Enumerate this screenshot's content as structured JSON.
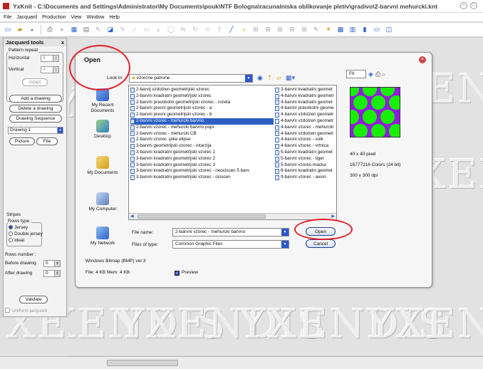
{
  "window": {
    "title": "YxKnit - C:\\Documents and Settings\\Administrator\\My Documents\\pouk\\NTF Bologna\\racunalniska oblikovanje pletiv\\gradivo\\2-barvni mehurcki.knt"
  },
  "menu": [
    "File",
    "Jacquard",
    "Production",
    "View",
    "Window",
    "Help"
  ],
  "watermark": "YXENDIS",
  "panel": {
    "title": "Jacquard tools",
    "close_label": "x",
    "pattern_repeat_label": "Pattern repeat",
    "horizontal_label": "Horizontal",
    "horizontal_value": "4",
    "vertical_label": "Vertical",
    "vertical_value": "4",
    "adapt_label": "Adapt",
    "add_drawing_label": "Add a drawing",
    "delete_drawing_label": "Delete a drawing",
    "drawing_sequence_label": "Drawing Sequence",
    "drawing_select_value": "Drawing 1",
    "picture_label": "Picture",
    "file_label": "File",
    "stripes_label": "Stripes",
    "rows_type_label": "Rows type :",
    "rows_types": [
      "Jersey",
      "Double jersey",
      "Ideal"
    ],
    "selected_row_type": "Jersey",
    "rows_number_label": "Rows number :",
    "before_drawing_label": "Before drawing",
    "before_drawing_value": "0",
    "after_drawing_label": "After drawing",
    "after_drawing_value": "0",
    "validate_label": "Validate",
    "uniform_jacquard_label": "Uniform jacquard"
  },
  "dialog": {
    "title": "Open",
    "look_in_label": "Look in:",
    "look_in_value": "vzorcne patrone",
    "view_mode_value": "Fit",
    "places": [
      "My Recent Documents",
      "Desktop",
      "My Documents",
      "My Computer",
      "My Network"
    ],
    "files_col1": [
      "2-barvij vzdolzen geometrijski vzorec",
      "2-barvni kvadratni geometrijski vzorec",
      "2-barvni pravokotni geometrijski vzorec - rozeta",
      "2-barvni precni geometrijski vzorec - a",
      "2-barvni precni geometrijski vzorec - b",
      "2-barvni vzorec - mehurcki barvno",
      "2-barvni vzorec - mehurcki barvno popr",
      "2-barvni vzorec - mehurcki CB",
      "2-barvni vzorec -pike elipse",
      "3-barvni geometrijski vzorec - intarzija",
      "3-barvni kvadratni geometrijski vzorec 1",
      "3-barvni kvadratni geometrijski vzorec 2",
      "3-barvni kvadratni geometrijski vzorec 3",
      "3-barvni kvadratni geometrijski vzorec - neociscen 5 barv",
      "3-barvni kvadratni geometrijski vzorec - ociscen"
    ],
    "selected_file": "2-barvni vzorec - mehurcki barvno",
    "files_col2": [
      "3-barvni kvadratni geomet",
      "4-barvni kvadratni geometr",
      "4-barvni kvadratni geomet",
      "4-barvni pravokotni geome",
      "4-barvni vzdolzen geometr",
      "4-barvni vzdolzen geometr",
      "4-barvni vzorec - mehurcki",
      "4-barvni vzdolzen geometr",
      "4-barvni vzorec - volk",
      "4-barvni vzorec - vrtnica",
      "5-barvni kvadratni geomet",
      "5-barvni vzorec - tiger",
      "5-barvni vzorec-macka",
      "6-barvni kvadratni geomet",
      "9-barvni vzorec - avion"
    ],
    "file_name_label": "File name:",
    "file_name_value": "2-barvni vzorec - mehurcki barvno",
    "files_of_type_label": "Files of type:",
    "files_of_type_value": "Common Graphic Files",
    "open_label": "Open",
    "cancel_label": "Cancel",
    "format_info": "Windows Bitmap (BMP) ver.3",
    "size_info": "File: 4 KB  Mem: 4 KB",
    "preview_label": "Preview",
    "image_size": "40 x 40 pixel",
    "colors_info": "16777216 Colors (24 bit)",
    "dpi_info": "300 x 300 dpi"
  },
  "colors": {
    "selection": "#2d5fc4",
    "annotation": "#e3202a",
    "pattern_bg": "#8d1fd8",
    "pattern_dots": "#19ef06"
  }
}
